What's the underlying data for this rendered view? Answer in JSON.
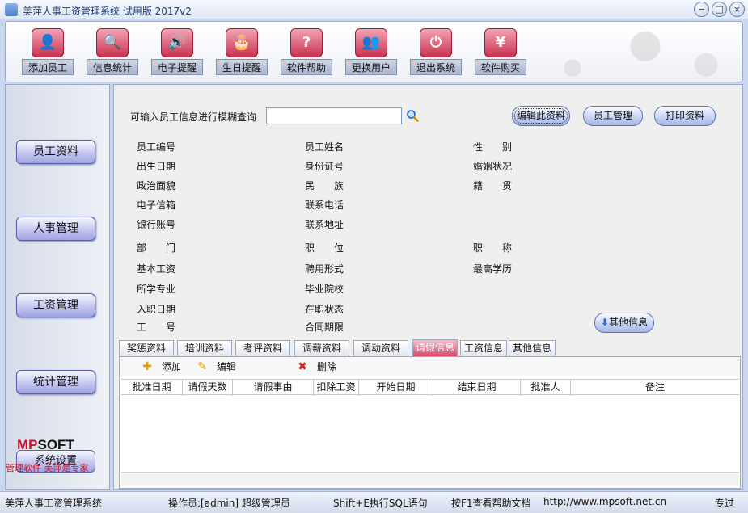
{
  "window": {
    "title": "美萍人事工资管理系统 试用版 2017v2",
    "min_glyph": "−",
    "max_glyph": "□",
    "close_glyph": "×"
  },
  "toolbar": {
    "items": [
      {
        "label": "添加员工",
        "icon": "user-add-icon",
        "glyph": "👤"
      },
      {
        "label": "信息统计",
        "icon": "search-stats-icon",
        "glyph": "🔍"
      },
      {
        "label": "电子提醒",
        "icon": "speaker-icon",
        "glyph": "🔊"
      },
      {
        "label": "生日提醒",
        "icon": "cake-icon",
        "glyph": "🎂"
      },
      {
        "label": "软件帮助",
        "icon": "help-icon",
        "glyph": "?"
      },
      {
        "label": "更换用户",
        "icon": "switch-user-icon",
        "glyph": "👥"
      },
      {
        "label": "退出系统",
        "icon": "power-icon",
        "glyph": "⏻"
      },
      {
        "label": "软件购买",
        "icon": "yen-icon",
        "glyph": "¥"
      }
    ]
  },
  "sidebar": {
    "items": [
      {
        "label": "员工资料"
      },
      {
        "label": "人事管理"
      },
      {
        "label": "工资管理"
      },
      {
        "label": "统计管理"
      }
    ],
    "logo_red": "MP",
    "logo_black": "SOFT",
    "system_settings": "系统设置",
    "slogan": "管理软件  美萍是专家"
  },
  "search": {
    "label": "可输入员工信息进行模糊查询",
    "value": "",
    "placeholder": ""
  },
  "actions": {
    "edit": "编辑此资料",
    "manage": "员工管理",
    "print": "打印资料",
    "other_info": "其他信息"
  },
  "fields": {
    "col1": [
      "员工编号",
      "出生日期",
      "政治面貌",
      "电子信箱",
      "银行账号",
      "部　　门",
      "基本工资",
      "所学专业",
      "入职日期",
      "工　　号"
    ],
    "col2": [
      "员工姓名",
      "身份证号",
      "民　　族",
      "联系电话",
      "联系地址",
      "职　　位",
      "聘用形式",
      "毕业院校",
      "在职状态",
      "合同期限"
    ],
    "col3": [
      "性　　别",
      "婚姻状况",
      "籍　　贯",
      "职　　称",
      "最高学历"
    ]
  },
  "tabs": [
    "奖惩资料",
    "培训资料",
    "考评资料",
    "调薪资料",
    "调动资料",
    "请假信息",
    "工资信息",
    "其他信息"
  ],
  "active_tab": "请假信息",
  "grid_actions": {
    "add": "添加",
    "edit": "编辑",
    "delete": "删除"
  },
  "grid": {
    "columns": [
      "批准日期",
      "请假天数",
      "请假事由",
      "扣除工资",
      "开始日期",
      "结束日期",
      "批准人",
      "备注"
    ],
    "rows": []
  },
  "status": {
    "app": "美萍人事工资管理系统",
    "operator": "操作员:[admin] 超级管理员",
    "sql_hint": "Shift+E执行SQL语句",
    "help_hint": "按F1查看帮助文档",
    "url": "http://www.mpsoft.net.cn",
    "edition": "专过"
  },
  "colors": {
    "accent_pink": "#d94a6c",
    "nav_blue": "#9ea4e0",
    "logo_red": "#c8102e"
  }
}
